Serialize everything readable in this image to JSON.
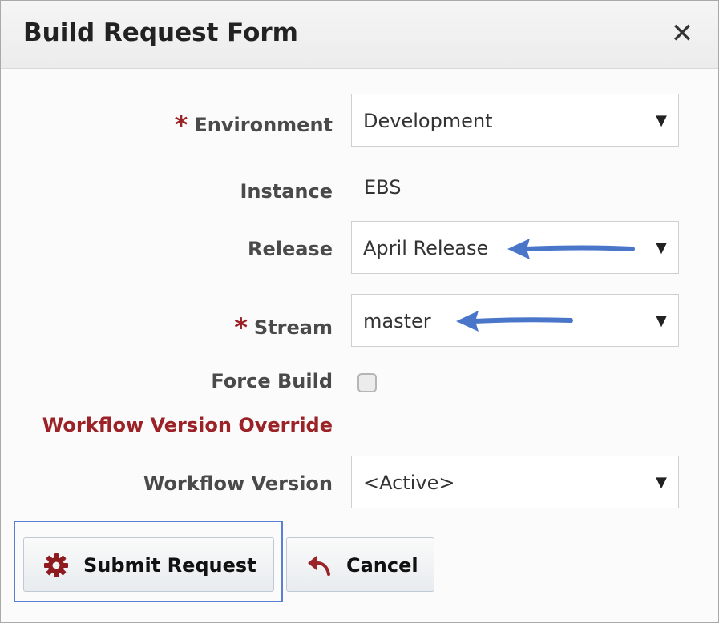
{
  "dialog": {
    "title": "Build Request Form",
    "close_icon": "close-icon"
  },
  "form": {
    "environment": {
      "label": "Environment",
      "required": true,
      "value": "Development"
    },
    "instance": {
      "label": "Instance",
      "value": "EBS"
    },
    "release": {
      "label": "Release",
      "value": "April Release"
    },
    "stream": {
      "label": "Stream",
      "required": true,
      "value": "master"
    },
    "force_build": {
      "label": "Force Build",
      "checked": false
    },
    "workflow_override_heading": "Workflow Version Override",
    "workflow_version": {
      "label": "Workflow Version",
      "value": "<Active>"
    },
    "required_marker": "*",
    "dropdown_arrow": "▼"
  },
  "buttons": {
    "submit_label": "Submit Request",
    "submit_icon": "gear-icon",
    "cancel_label": "Cancel",
    "cancel_icon": "undo-arrow-icon"
  },
  "colors": {
    "required": "#9b2226",
    "annotation_arrow": "#4a76c9",
    "focus_ring": "#5b7fd1"
  }
}
